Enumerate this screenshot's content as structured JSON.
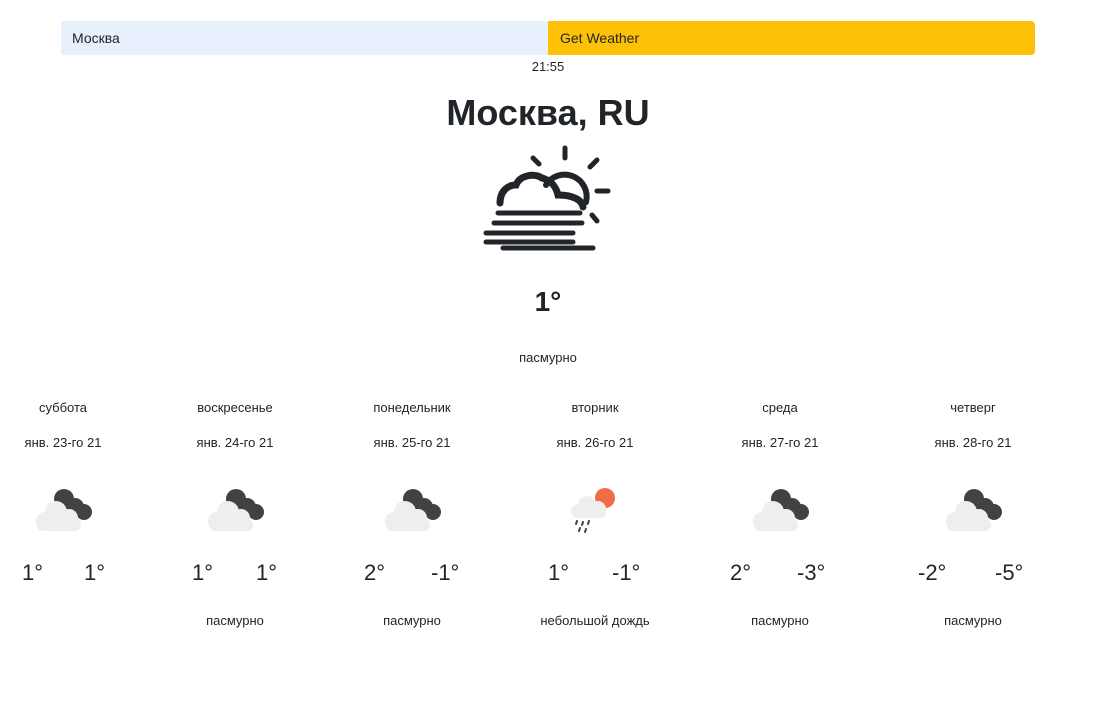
{
  "search": {
    "input_value": "Москва",
    "button_label": "Get Weather"
  },
  "current": {
    "time": "21:55",
    "city": "Москва, RU",
    "icon": "partly-cloudy-day-fog-icon",
    "temp": "1°",
    "description": "пасмурно"
  },
  "forecast": [
    {
      "day": "суббота",
      "date": "янв. 23-го 21",
      "icon": "cloudy-night-icon",
      "max": "1°",
      "min": "1°",
      "description": ""
    },
    {
      "day": "воскресенье",
      "date": "янв. 24-го 21",
      "icon": "cloudy-night-icon",
      "max": "1°",
      "min": "1°",
      "description": "пасмурно"
    },
    {
      "day": "понедельник",
      "date": "янв. 25-го 21",
      "icon": "cloudy-night-icon",
      "max": "2°",
      "min": "-1°",
      "description": "пасмурно"
    },
    {
      "day": "вторник",
      "date": "янв. 26-го 21",
      "icon": "rain-sun-icon",
      "max": "1°",
      "min": "-1°",
      "description": "небольшой дождь"
    },
    {
      "day": "среда",
      "date": "янв. 27-го 21",
      "icon": "cloudy-night-icon",
      "max": "2°",
      "min": "-3°",
      "description": "пасмурно"
    },
    {
      "day": "четверг",
      "date": "янв. 28-го 21",
      "icon": "cloudy-night-icon",
      "max": "-2°",
      "min": "-5°",
      "description": "пасмурно"
    }
  ],
  "colors": {
    "input_bg": "#e8f0fe",
    "button_bg": "#ffc107",
    "sun_orange": "#f06b46",
    "cloud_dark": "#424242",
    "cloud_light": "#eeeeee"
  }
}
